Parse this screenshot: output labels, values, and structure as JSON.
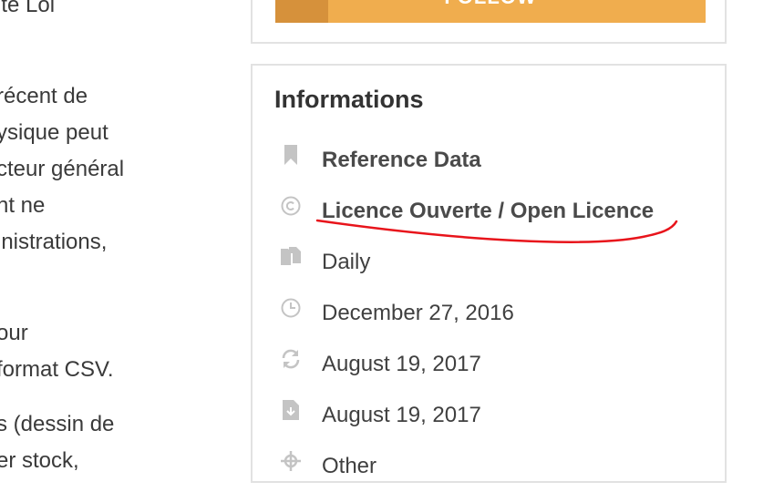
{
  "article": {
    "lines": [
      "ite Loi",
      "",
      "récent de",
      "ysique peut",
      "cteur général",
      "nt ne",
      "inistrations,",
      "",
      "our",
      "format CSV.",
      "",
      "s (dessin de",
      "er stock,"
    ]
  },
  "follow": {
    "label": "FOLLOW"
  },
  "info": {
    "title": "Informations",
    "items": [
      {
        "icon": "bookmark-icon",
        "text": "Reference Data"
      },
      {
        "icon": "copyright-icon",
        "text": "Licence Ouverte / Open Licence"
      },
      {
        "icon": "files-icon",
        "text": "Daily"
      },
      {
        "icon": "clock-icon",
        "text": "December 27, 2016"
      },
      {
        "icon": "refresh-icon",
        "text": "August 19, 2017"
      },
      {
        "icon": "file-download-icon",
        "text": "August 19, 2017"
      },
      {
        "icon": "crosshair-icon",
        "text": "Other"
      }
    ]
  },
  "colors": {
    "follow_button": "#f0ad4e",
    "annotation_underline": "#e8141b"
  }
}
